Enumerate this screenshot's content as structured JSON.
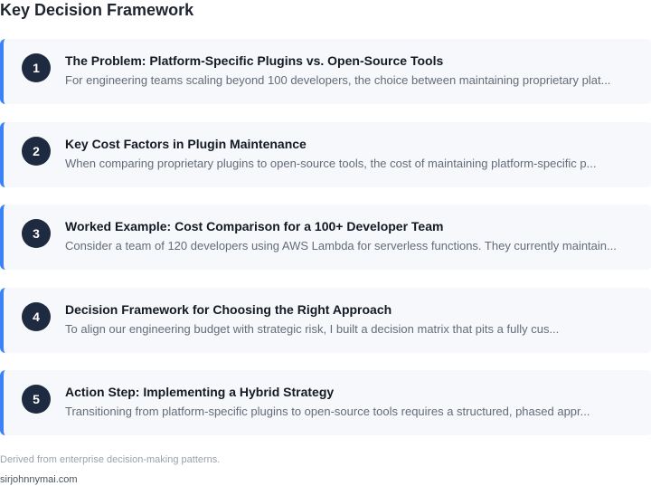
{
  "header": {
    "title": "Key Decision Framework"
  },
  "steps": [
    {
      "number": "1",
      "title": "The Problem: Platform-Specific Plugins vs. Open-Source Tools",
      "excerpt": "For engineering teams scaling beyond 100 developers, the choice between maintaining proprietary plat..."
    },
    {
      "number": "2",
      "title": "Key Cost Factors in Plugin Maintenance",
      "excerpt": "When comparing proprietary plugins to open-source tools, the cost of maintaining platform-specific p..."
    },
    {
      "number": "3",
      "title": "Worked Example: Cost Comparison for a 100+ Developer Team",
      "excerpt": "Consider a team of 120 developers using AWS Lambda for serverless functions. They currently maintain..."
    },
    {
      "number": "4",
      "title": "Decision Framework for Choosing the Right Approach",
      "excerpt": "To align our engineering budget with strategic risk, I built a decision matrix that pits a fully cus..."
    },
    {
      "number": "5",
      "title": "Action Step: Implementing a Hybrid Strategy",
      "excerpt": "Transitioning from platform-specific plugins to open-source tools requires a structured, phased appr..."
    }
  ],
  "footer": {
    "note": "Derived from enterprise decision-making patterns.",
    "site": "sirjohnnymai.com"
  },
  "colors": {
    "accent": "#3b82f6",
    "badge": "#1e2a40",
    "card_background": "#f6f8fb"
  }
}
